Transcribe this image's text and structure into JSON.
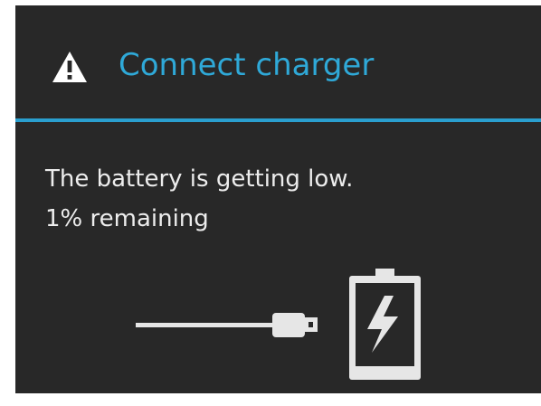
{
  "dialog": {
    "title": "Connect charger",
    "message_line1": "The battery is getting low.",
    "message_line2": "1% remaining"
  },
  "icons": {
    "title_icon": "warning-triangle-icon",
    "cable_icon": "usb-cable-icon",
    "battery_icon": "charging-battery-icon"
  },
  "colors": {
    "accent": "#2fa9d8",
    "divider": "#2a9fcf",
    "background": "#282828",
    "text": "#ededed",
    "icon": "#e6e6e6"
  },
  "battery": {
    "level_percent": 1
  }
}
